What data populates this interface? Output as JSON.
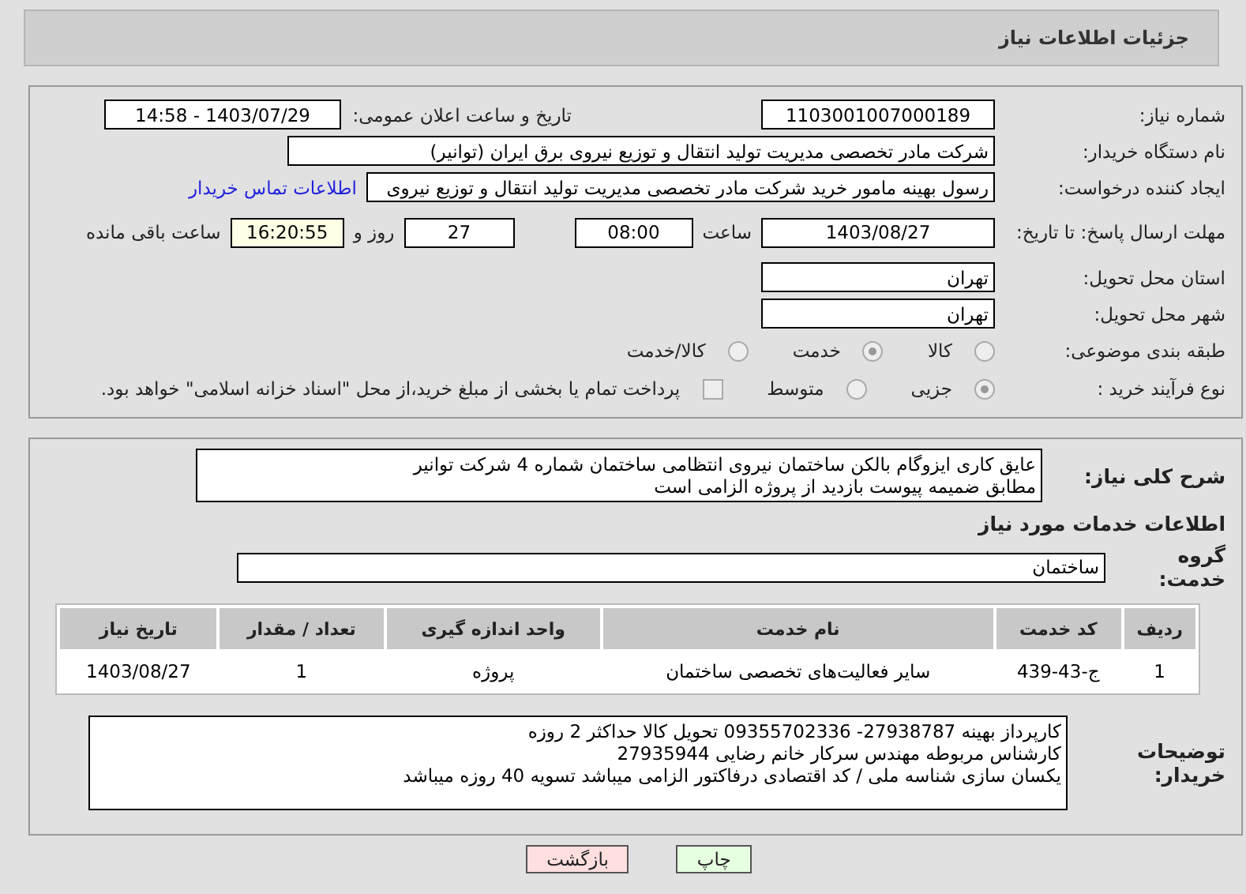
{
  "header": {
    "title": "جزئیات اطلاعات نیاز"
  },
  "need_number": {
    "label": "شماره نیاز:",
    "value": "1103001007000189"
  },
  "announce": {
    "label": "تاریخ و ساعت اعلان عمومی:",
    "value": "1403/07/29 - 14:58"
  },
  "buyer_org": {
    "label": "نام دستگاه خریدار:",
    "value": "شرکت مادر تخصصی مدیریت تولید  انتقال و توزیع نیروی برق ایران (توانیر)"
  },
  "requester": {
    "label": "ایجاد کننده درخواست:",
    "value": "رسول بهینه مامور خرید شرکت مادر تخصصی مدیریت تولید  انتقال و توزیع نیروی",
    "link": "اطلاعات تماس خریدار"
  },
  "deadline": {
    "label": "مهلت ارسال پاسخ: تا تاریخ:",
    "date": "1403/08/27",
    "time_label": "ساعت",
    "time": "08:00",
    "days": "27",
    "days_label": "روز و",
    "remaining": "16:20:55",
    "remaining_label": "ساعت باقی مانده"
  },
  "province": {
    "label": "استان محل تحویل:",
    "value": "تهران"
  },
  "city": {
    "label": "شهر محل تحویل:",
    "value": "تهران"
  },
  "category": {
    "label": "طبقه بندی موضوعی:",
    "options": [
      {
        "label": "کالا",
        "selected": false
      },
      {
        "label": "خدمت",
        "selected": true
      },
      {
        "label": "کالا/خدمت",
        "selected": false
      }
    ]
  },
  "process": {
    "label": "نوع فرآیند خرید :",
    "options": [
      {
        "label": "جزیی",
        "selected": true
      },
      {
        "label": "متوسط",
        "selected": false
      }
    ],
    "payment": {
      "label": "پرداخت تمام یا بخشی از مبلغ خرید،از محل \"اسناد خزانه اسلامی\" خواهد بود.",
      "checked": false
    }
  },
  "description": {
    "label": "شرح کلی نیاز:",
    "lines": [
      "عایق کاری ایزوگام بالکن ساختمان نیروی انتظامی ساختمان شماره 4 شرکت توانیر",
      "مطابق ضمیمه پیوست بازدید از پروژه الزامی است"
    ]
  },
  "services_heading": "اطلاعات خدمات مورد نیاز",
  "service_group": {
    "label": "گروه خدمت:",
    "value": "ساختمان"
  },
  "table": {
    "columns": [
      "ردیف",
      "کد خدمت",
      "نام خدمت",
      "واحد اندازه گیری",
      "تعداد / مقدار",
      "تاریخ نیاز"
    ],
    "rows": [
      [
        "1",
        "ج-43-439",
        "سایر فعالیت‌های تخصصی ساختمان",
        "پروژه",
        "1",
        "1403/08/27"
      ]
    ]
  },
  "buyer_notes": {
    "label": "توضیحات خریدار:",
    "lines": [
      "کارپرداز بهینه 27938787-  09355702336   تحویل کالا حداکثر 2 روزه",
      "کارشناس مربوطه مهندس سرکار خانم رضایی 27935944",
      "یکسان سازی شناسه ملی / کد اقتصادی درفاکتور الزامی میباشد  تسویه 40 روزه میباشد"
    ]
  },
  "buttons": [
    {
      "label": "چاپ",
      "kind": "print"
    },
    {
      "label": "بازگشت",
      "kind": "back"
    }
  ]
}
